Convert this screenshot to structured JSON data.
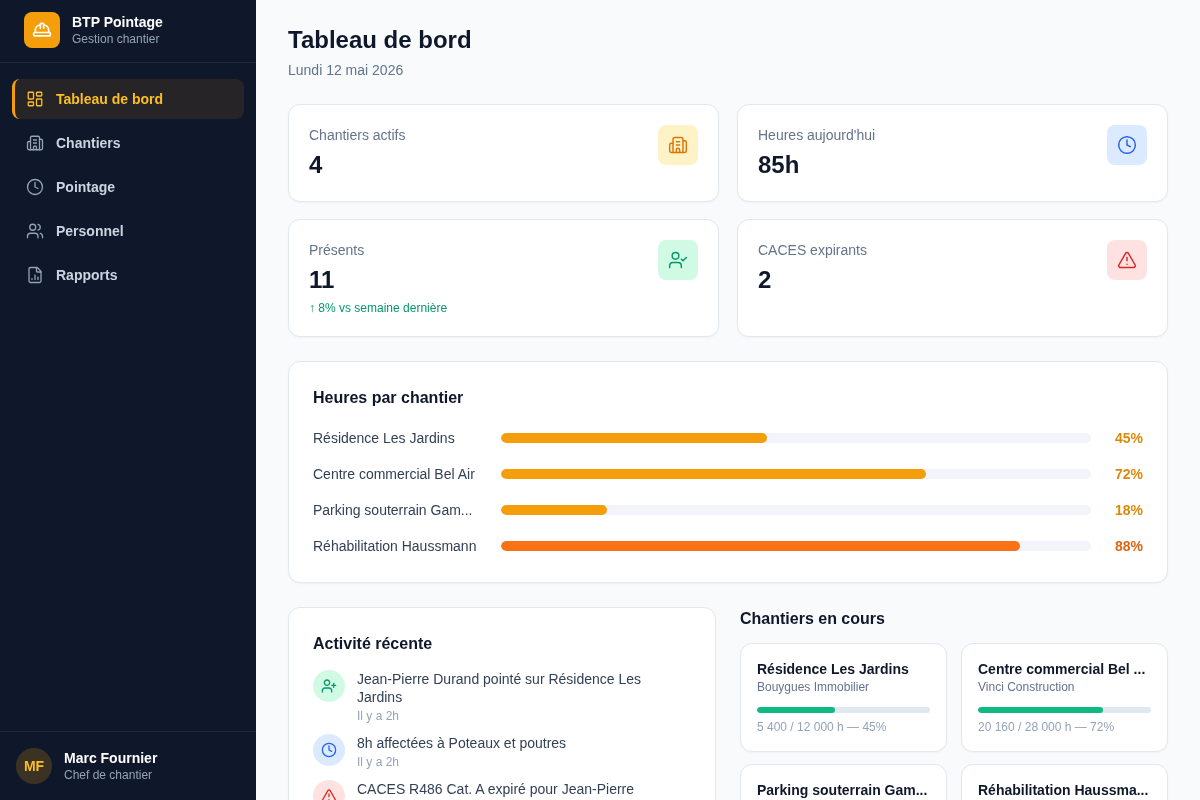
{
  "sidebar": {
    "brand": {
      "title": "BTP Pointage",
      "subtitle": "Gestion chantier"
    },
    "nav": [
      {
        "label": "Tableau de bord",
        "selected": true
      },
      {
        "label": "Chantiers",
        "selected": false
      },
      {
        "label": "Pointage",
        "selected": false
      },
      {
        "label": "Personnel",
        "selected": false
      },
      {
        "label": "Rapports",
        "selected": false
      }
    ],
    "user": {
      "initials": "MF",
      "name": "Marc Fournier",
      "role": "Chef de chantier"
    }
  },
  "header": {
    "title": "Tableau de bord",
    "date": "Lundi 12 mai 2026"
  },
  "stats": [
    {
      "label": "Chantiers actifs",
      "value": "4",
      "color": "#fef3c7"
    },
    {
      "label": "Heures aujourd'hui",
      "value": "85h",
      "color": "#dbeafe"
    },
    {
      "label": "Présents",
      "value": "11",
      "trend": "↑ 8% vs semaine dernière",
      "color": "#d1fae5"
    },
    {
      "label": "CACES expirants",
      "value": "2",
      "color": "#fee2e2"
    }
  ],
  "hours_by_site": {
    "title": "Heures par chantier",
    "rows": [
      {
        "name": "Résidence Les Jardins",
        "level": 0.45,
        "reading": "45%",
        "color": "#f59e0b"
      },
      {
        "name": "Centre commercial Bel Air",
        "level": 0.72,
        "reading": "72%",
        "color": "#f59e0b"
      },
      {
        "name": "Parking souterrain Gam...",
        "level": 0.18,
        "reading": "18%",
        "color": "#f59e0b"
      },
      {
        "name": "Réhabilitation Haussmann",
        "level": 0.88,
        "reading": "88%",
        "color": "#f97316"
      }
    ]
  },
  "activity": {
    "title": "Activité récente",
    "items": [
      {
        "text": "Jean-Pierre Durand pointé sur Résidence Les Jardins",
        "time": "Il y a 2h",
        "color": "#d1fae5"
      },
      {
        "text": "8h affectées à Poteaux et poutres",
        "time": "Il y a 2h",
        "color": "#dbeafe"
      },
      {
        "text": "CACES R486 Cat. A expiré pour Jean-Pierre",
        "color": "#fee2e2"
      }
    ]
  },
  "sites": {
    "title": "Chantiers en cours",
    "cards": [
      {
        "name": "Résidence Les Jardins",
        "client": "Bouygues Immobilier",
        "level": 0.45,
        "progress": "5 400 / 12 000 h — 45%"
      },
      {
        "name": "Centre commercial Bel ...",
        "client": "Vinci Construction",
        "level": 0.72,
        "progress": "20 160 / 28 000 h — 72%"
      },
      {
        "name": "Parking souterrain Gam..."
      },
      {
        "name": "Réhabilitation Haussma..."
      }
    ]
  }
}
